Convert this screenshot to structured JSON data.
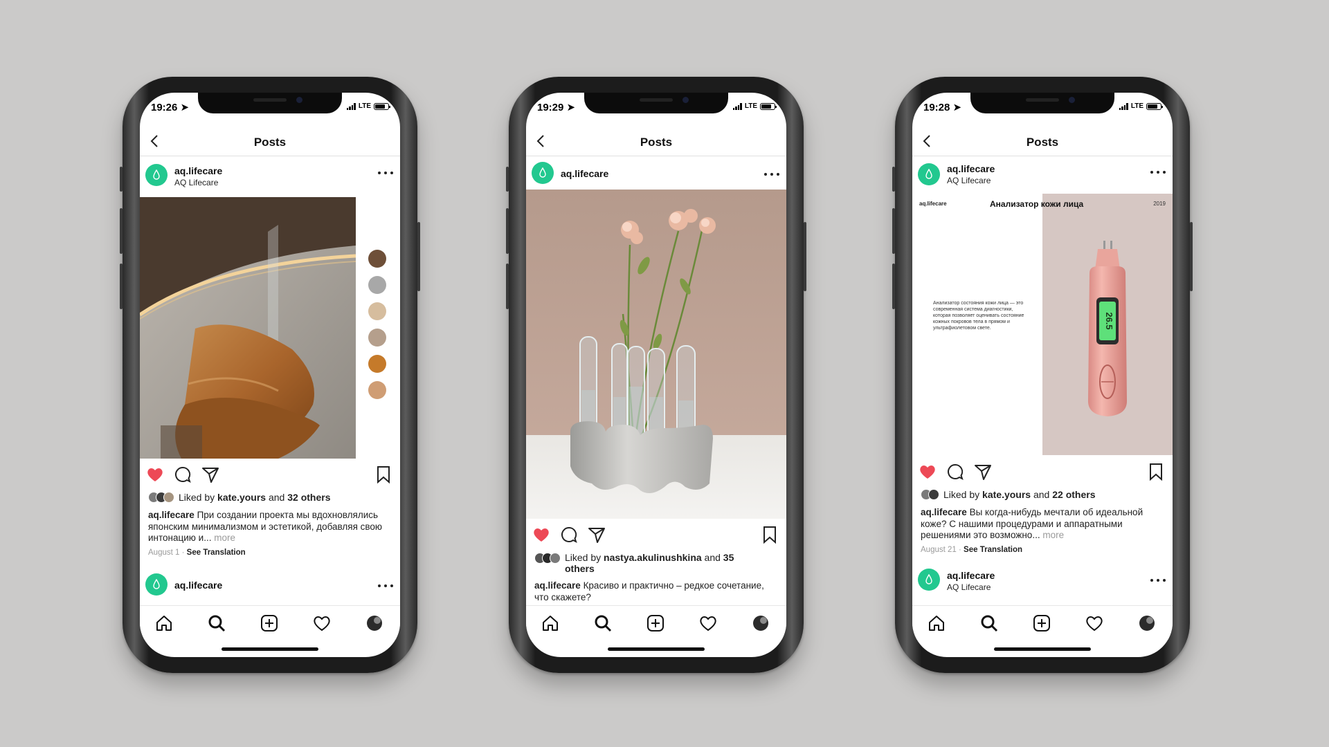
{
  "phones": [
    {
      "status_time": "19:26",
      "network": "LTE",
      "header_title": "Posts",
      "post": {
        "username": "aq.lifecare",
        "subtitle": "AQ Lifecare",
        "liked_by_prefix": "Liked by",
        "liked_by_user": "kate.yours",
        "liked_and": "and",
        "liked_others": "32 others",
        "caption_user": "aq.lifecare",
        "caption_text": "При создании проекта мы вдохновлялись японским минимализмом и эстетикой, добавляя свою интонацию и...",
        "more_label": "more",
        "date": "August 1",
        "separator": "·",
        "see_translation": "See Translation",
        "palette": [
          "#6e4f38",
          "#a8a8a8",
          "#d6bd9e",
          "#b59f8c",
          "#c57a2a",
          "#cf9d74"
        ]
      },
      "next_post": {
        "username": "aq.lifecare",
        "subtitle": ""
      }
    },
    {
      "status_time": "19:29",
      "network": "LTE",
      "header_title": "Posts",
      "post": {
        "username": "aq.lifecare",
        "liked_by_prefix": "Liked by",
        "liked_by_user": "nastya.akulinushkina",
        "liked_and": "and",
        "liked_others": "35 others",
        "caption_user": "aq.lifecare",
        "caption_text": "Красиво и практично – редкое сочетание, что скажете?"
      }
    },
    {
      "status_time": "19:28",
      "network": "LTE",
      "header_title": "Posts",
      "post": {
        "username": "aq.lifecare",
        "subtitle": "AQ Lifecare",
        "image_brand": "aq.lifecare",
        "image_title": "Анализатор кожи лица",
        "image_year": "2019",
        "image_text": "Анализатор состояния кожи лица — это современная система диагностики, которая позволяет оценивать состояние кожных покровов тела в прямом и ультрафиолетовом свете.",
        "device_reading": "26.5",
        "liked_by_prefix": "Liked by",
        "liked_by_user": "kate.yours",
        "liked_and": "and",
        "liked_others": "22 others",
        "caption_user": "aq.lifecare",
        "caption_text": "Вы когда-нибудь мечтали об идеальной коже? С нашими процедурами и аппаратными решениями это возможно...",
        "more_label": "more",
        "date": "August 21",
        "separator": "·",
        "see_translation": "See Translation"
      },
      "next_post": {
        "username": "aq.lifecare",
        "subtitle": "AQ Lifecare"
      }
    }
  ],
  "colors": {
    "background": "#cbcac9",
    "accent_green": "#22c88f",
    "like_red": "#ed4956",
    "muted_text": "#9a9a9a"
  },
  "icons": {
    "back": "chevron-left-icon",
    "more": "more-dots-icon",
    "like": "heart-filled-icon",
    "comment": "comment-icon",
    "share": "paper-plane-icon",
    "save": "bookmark-icon",
    "tabs": [
      "home-icon",
      "search-icon",
      "add-post-icon",
      "activity-heart-icon",
      "profile-avatar-icon"
    ]
  }
}
